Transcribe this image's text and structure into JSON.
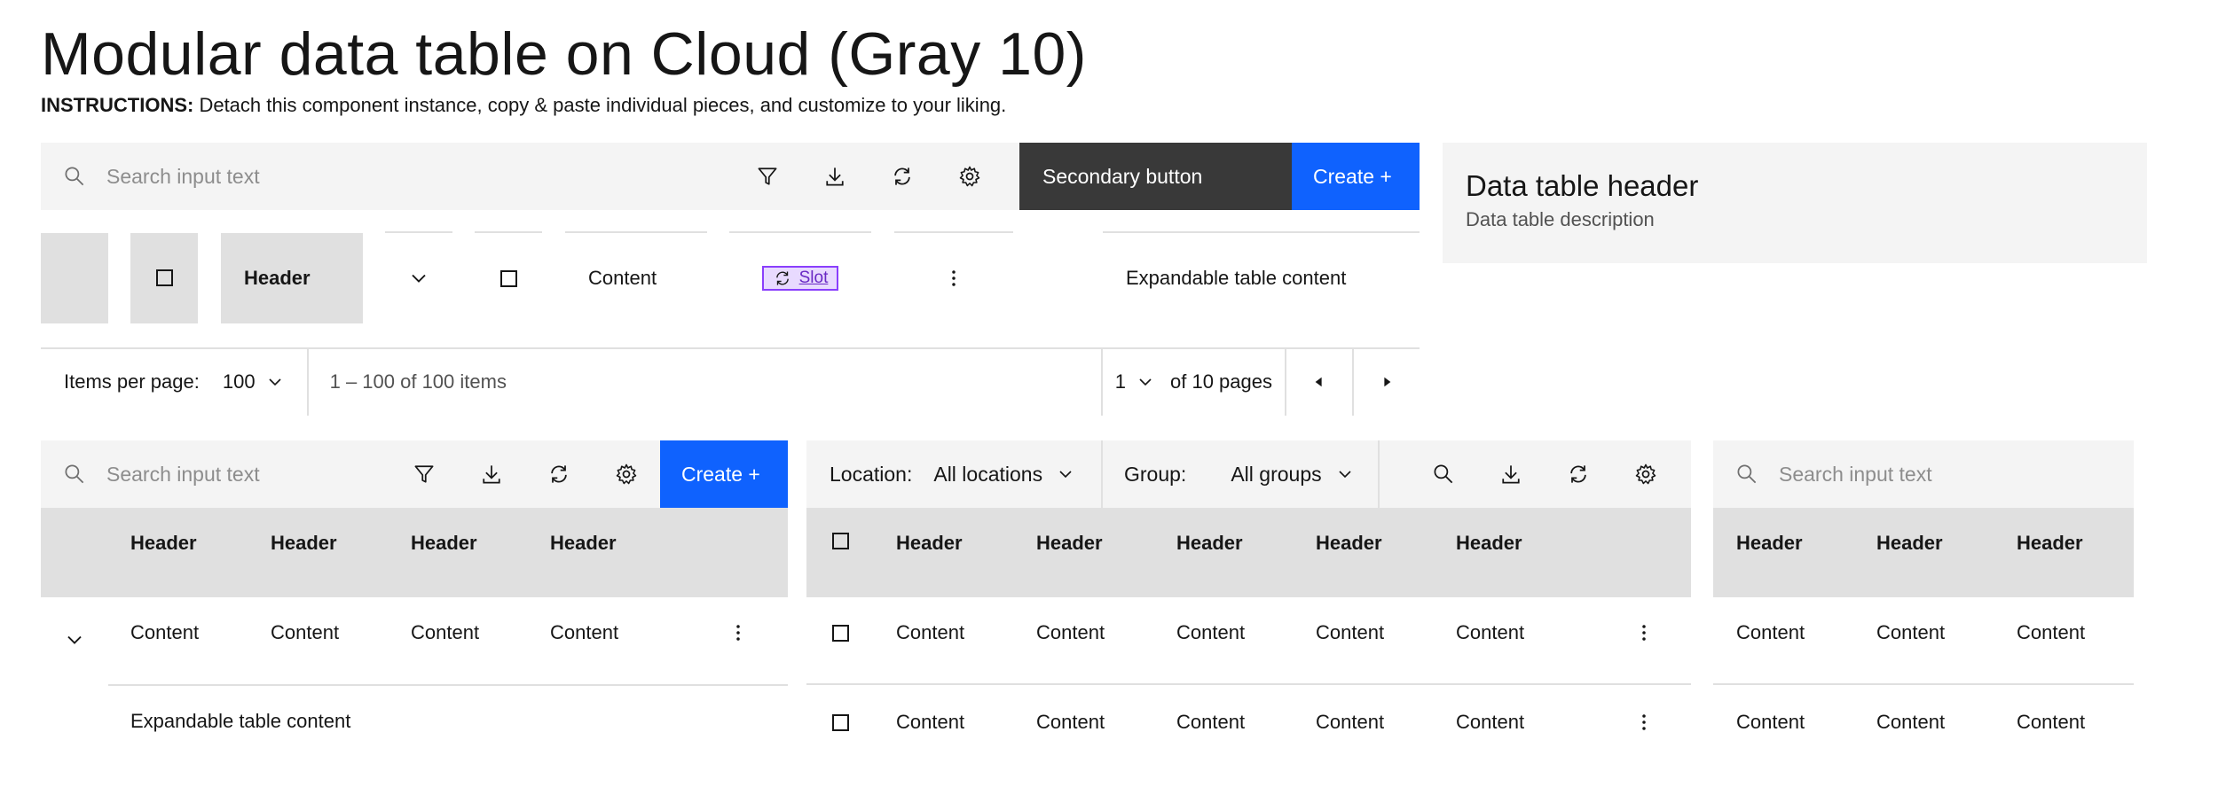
{
  "page": {
    "title": "Modular data table on Cloud (Gray 10)",
    "instructions_label": "INSTRUCTIONS:",
    "instructions_text": " Detach this component instance, copy & paste individual pieces, and customize to your liking."
  },
  "colors": {
    "primary": "#0f62fe",
    "secondary": "#393939",
    "layer": "#f4f4f4",
    "header": "#e0e0e0",
    "slot": "#8a3ffc"
  },
  "toolbar_top": {
    "search_placeholder": "Search input text",
    "icons": [
      "search-icon",
      "filter-icon",
      "download-icon",
      "renew-icon",
      "settings-icon"
    ],
    "secondary_label": "Secondary button",
    "primary_label": "Create +"
  },
  "pieces_row": {
    "header_label": "Header",
    "content_label": "Content",
    "slot_label": "Slot",
    "expandable_label": "Expandable table content"
  },
  "header_card": {
    "title": "Data table header",
    "description": "Data table description"
  },
  "pagination": {
    "items_per_page_label": "Items per page:",
    "items_per_page_value": "100",
    "range_text": "1 – 100 of 100 items",
    "page_value": "1",
    "pages_text": "of 10 pages"
  },
  "table_a": {
    "search_placeholder": "Search input text",
    "primary_label": "Create +",
    "headers": [
      "Header",
      "Header",
      "Header",
      "Header"
    ],
    "row": [
      "Content",
      "Content",
      "Content",
      "Content"
    ],
    "expanded_text": "Expandable table content"
  },
  "table_b": {
    "location_label": "Location:",
    "location_value": "All locations",
    "group_label": "Group:",
    "group_value": "All groups",
    "headers": [
      "Header",
      "Header",
      "Header",
      "Header",
      "Header"
    ],
    "rows": [
      [
        "Content",
        "Content",
        "Content",
        "Content",
        "Content"
      ],
      [
        "Content",
        "Content",
        "Content",
        "Content",
        "Content"
      ]
    ]
  },
  "table_c": {
    "search_placeholder": "Search input text",
    "headers": [
      "Header",
      "Header",
      "Header"
    ],
    "rows": [
      [
        "Content",
        "Content",
        "Content"
      ],
      [
        "Content",
        "Content",
        "Content"
      ]
    ]
  }
}
